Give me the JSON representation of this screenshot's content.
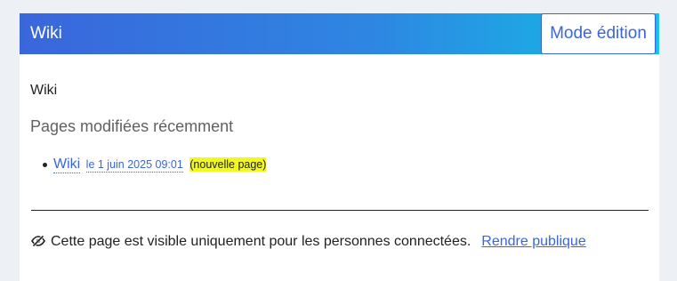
{
  "header": {
    "title": "Wiki",
    "edit_mode_label": "Mode édition"
  },
  "page": {
    "heading": "Wiki"
  },
  "recent": {
    "title": "Pages modifiées récemment",
    "items": [
      {
        "page": "Wiki",
        "date": "le 1 juin 2025 09:01",
        "badge": "(nouvelle page)"
      }
    ]
  },
  "visibility": {
    "icon": "eye-slash-icon",
    "text": "Cette page est visible uniquement pour les personnes connectées.",
    "action_label": "Rendre publique"
  },
  "colors": {
    "accent": "#3a66dc",
    "gradient_end": "#13bde6",
    "highlight": "#f3f91f"
  }
}
